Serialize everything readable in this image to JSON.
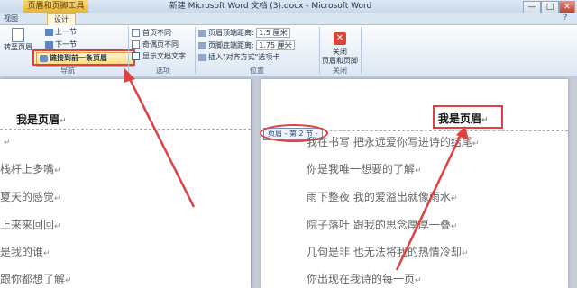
{
  "window": {
    "contextual_tab": "页眉和页脚工具",
    "title": "新建 Microsoft Word 文档 (3).docx - Microsoft Word",
    "minimize": "—",
    "maximize": "□",
    "close": "✕"
  },
  "tabs": {
    "view": "视图",
    "design": "设计",
    "help": "?"
  },
  "ribbon": {
    "nav": {
      "goto_header": "转至页眉",
      "prev_section": "上一节",
      "next_section": "下一节",
      "link_previous": "链接到前一条页眉",
      "label": "导航"
    },
    "options": {
      "different_first": "首页不同",
      "different_odd_even": "奇偶页不同",
      "show_doc_text": "显示文档文字",
      "label": "选项"
    },
    "position": {
      "header_top_label": "页眉顶端距离:",
      "header_top_value": "1.5 厘米",
      "footer_bottom_label": "页脚底端距离:",
      "footer_bottom_value": "1.75 厘米",
      "insert_align_tab": "插入\"对齐方式\"选项卡",
      "label": "位置"
    },
    "close": {
      "button_line1": "关闭",
      "button_line2": "页眉和页脚",
      "label": "关闭"
    }
  },
  "left_page": {
    "header": "我是页眉",
    "lines": [
      "栈杆上多嘴",
      "夏天的感觉",
      "上来来回回",
      "是我的谁",
      "跟你都想了解"
    ]
  },
  "right_page": {
    "header": "我是页眉",
    "section_tag": "页眉 - 第 2 节 -",
    "lines": [
      "我在书写  把永远爱你写进诗的结尾",
      "你是我唯一想要的了解",
      "雨下整夜  我的爱溢出就像雨水",
      "院子落叶  跟我的思念厚厚一叠",
      "几句是非  也无法将我的热情冷却",
      "你出现在我诗的每一页"
    ]
  },
  "colors": {
    "annotation": "#e04040",
    "ribbon_highlight": "#ffd978"
  }
}
